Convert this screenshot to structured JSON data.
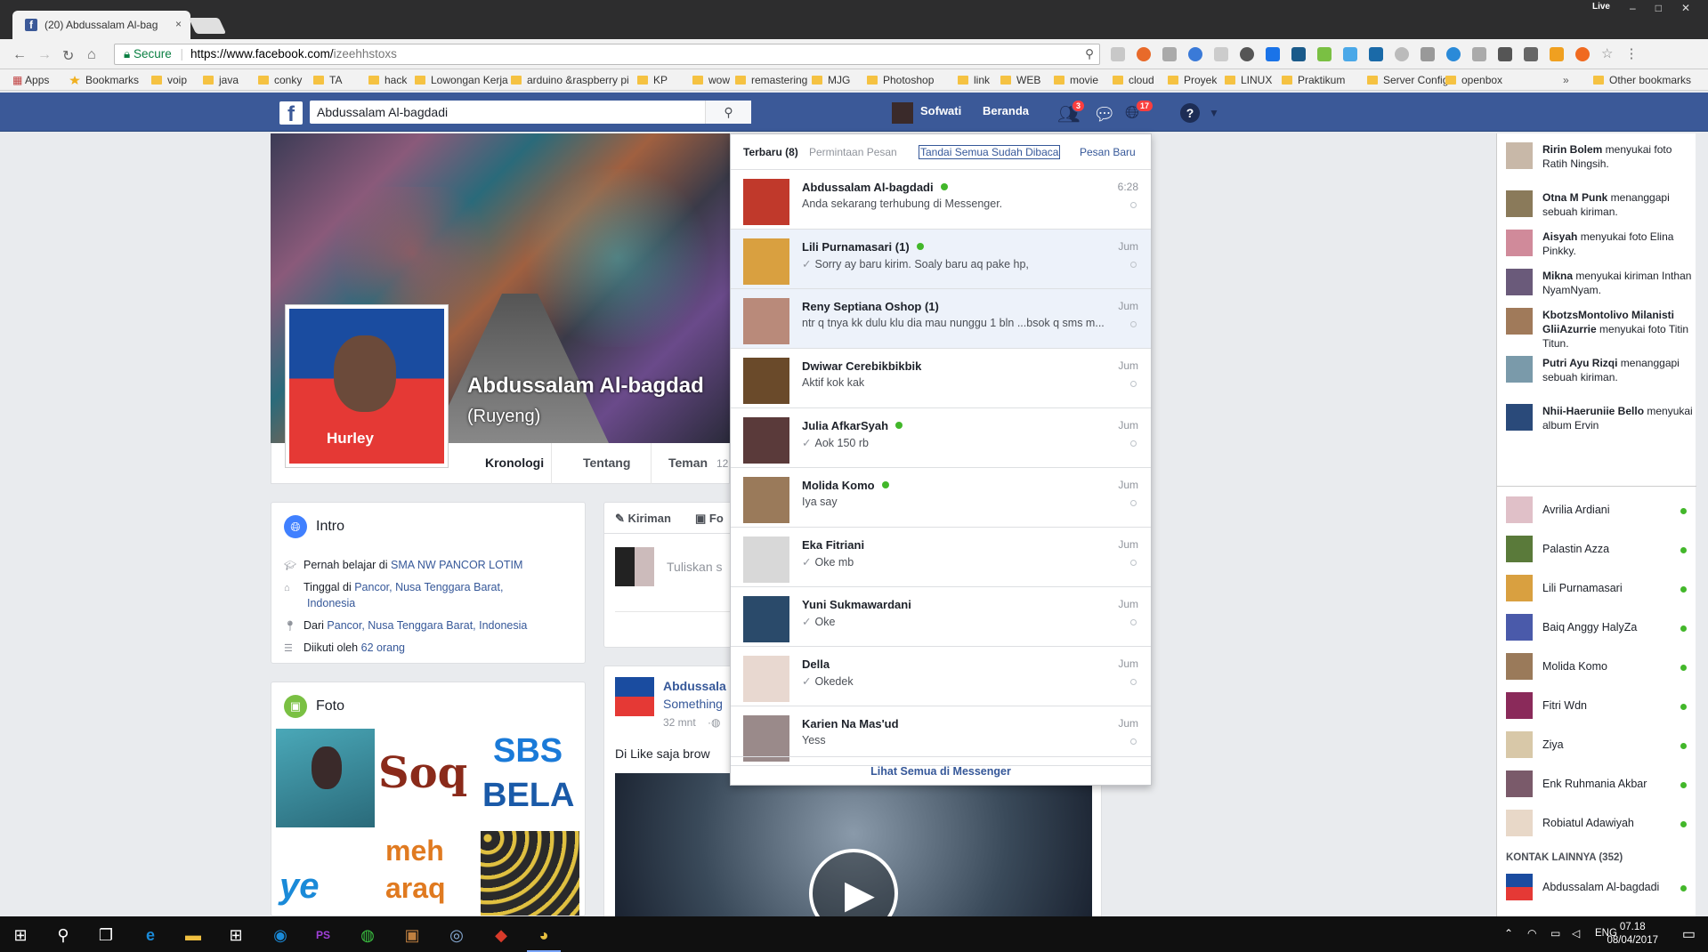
{
  "browser": {
    "tab_title": "(20) Abdussalam Al-bag",
    "tab_close": "×",
    "live_label": "Live",
    "secure_label": "Secure",
    "url_host": "https://www.facebook.com/",
    "url_path": "izeehhstoxs"
  },
  "bookmarks": {
    "apps": "Apps",
    "items": [
      "Bookmarks",
      "voip",
      "java",
      "conky",
      "TA",
      "hack",
      "Lowongan Kerja",
      "arduino &raspberry pi",
      "KP",
      "wow",
      "remastering",
      "MJG",
      "Photoshop",
      "link",
      "WEB",
      "movie",
      "cloud",
      "Proyek",
      "LINUX",
      "Praktikum",
      "Server Config",
      "openbox"
    ],
    "overflow": "»",
    "other": "Other bookmarks"
  },
  "fb": {
    "logo": "f",
    "search_value": "Abdussalam Al-bagdadi",
    "user_name": "Sofwati",
    "home_label": "Beranda",
    "friend_badge": "3",
    "notif_badge": "17"
  },
  "profile": {
    "name": "Abdussalam Al-bagdad",
    "alt_name": "(Ruyeng)",
    "shirt_text": "Hurley",
    "tabs": [
      "Kronologi",
      "Tentang",
      "Teman"
    ],
    "friends_count": "12"
  },
  "intro": {
    "title": "Intro",
    "studied_prefix": "Pernah belajar di ",
    "studied_link": "SMA NW PANCOR LOTIM",
    "lives_prefix": "Tinggal di ",
    "lives_link": "Pancor, Nusa Tenggara Barat,",
    "lives_link2": "Indonesia",
    "from_prefix": "Dari ",
    "from_link": "Pancor, Nusa Tenggara Barat, Indonesia",
    "followed_prefix": "Diikuti oleh ",
    "followed_link": "62 orang"
  },
  "photos": {
    "title": "Foto",
    "tile_texts": [
      "Soq",
      "SBS",
      "BELA",
      "meh",
      "araq",
      "ye"
    ]
  },
  "composer": {
    "tab_post": "Kiriman",
    "tab_photo": "Fo",
    "placeholder": "Tuliskan s"
  },
  "post": {
    "author": "Abdussala",
    "subtitle": "Something",
    "time": "32 mnt",
    "text": "Di Like saja brow"
  },
  "messenger": {
    "tab_recent": "Terbaru (8)",
    "tab_requests": "Permintaan Pesan",
    "mark_read": "Tandai Semua Sudah Dibaca",
    "new_message": "Pesan Baru",
    "footer": "Lihat Semua di Messenger",
    "threads": [
      {
        "name": "Abdussalam Al-bagdadi",
        "online": true,
        "check": false,
        "preview": "Anda sekarang terhubung di Messenger.",
        "time": "6:28",
        "unread": false,
        "color": "#c0392b"
      },
      {
        "name": "Lili Purnamasari (1)",
        "online": true,
        "check": true,
        "preview": "Sorry ay baru kirim. Soaly baru aq pake hp,",
        "time": "Jum",
        "unread": true,
        "color": "#d9a040"
      },
      {
        "name": "Reny Septiana Oshop (1)",
        "online": false,
        "check": false,
        "preview": "ntr q tnya kk dulu klu dia mau nunggu 1 bln ...bsok q sms m...",
        "time": "Jum",
        "unread": true,
        "color": "#b98a7a"
      },
      {
        "name": "Dwiwar Cerebikbikbik",
        "online": false,
        "check": false,
        "preview": "Aktif kok kak",
        "time": "Jum",
        "unread": false,
        "color": "#6a4a2a"
      },
      {
        "name": "Julia AfkarSyah",
        "online": true,
        "check": true,
        "preview": "Aok 150 rb",
        "time": "Jum",
        "unread": false,
        "color": "#5a3a3a"
      },
      {
        "name": "Molida Komo",
        "online": true,
        "check": false,
        "preview": "Iya say",
        "time": "Jum",
        "unread": false,
        "color": "#9a7a5a"
      },
      {
        "name": "Eka Fitriani",
        "online": false,
        "check": true,
        "preview": "Oke mb",
        "time": "Jum",
        "unread": false,
        "color": "#d8d8d8"
      },
      {
        "name": "Yuni Sukmawardani",
        "online": false,
        "check": true,
        "preview": "Oke",
        "time": "Jum",
        "unread": false,
        "color": "#2a4a6a"
      },
      {
        "name": "Della",
        "online": false,
        "check": true,
        "preview": "Okedek",
        "time": "Jum",
        "unread": false,
        "color": "#e8d8d0"
      },
      {
        "name": "Karien Na Mas'ud",
        "online": false,
        "check": false,
        "preview": "Yess",
        "time": "Jum",
        "unread": false,
        "color": "#9a8a8a"
      }
    ]
  },
  "ticker": [
    {
      "name": "Ririn Bolem",
      "rest": " menyukai foto Ratih Ningsih.",
      "color": "#c8b8a8"
    },
    {
      "name": "Otna M Punk",
      "rest": " menanggapi sebuah kiriman.",
      "color": "#8a7a5a"
    },
    {
      "name": "Aisyah",
      "rest": " menyukai foto Elina Pinkky.",
      "color": "#d08a9a"
    },
    {
      "name": "Mikna",
      "rest": " menyukai kiriman Inthan NyamNyam.",
      "color": "#6a5a7a"
    },
    {
      "name": "KbotzsMontolivo Milanisti GliiAzurrie",
      "rest": " menyukai foto Titin Titun.",
      "color": "#a07a5a"
    },
    {
      "name": "Putri Ayu Rizqi",
      "rest": " menanggapi sebuah kiriman.",
      "color": "#7a9aaa"
    },
    {
      "name": "Nhii-Haeruniie Bello",
      "rest": " menyukai album Ervin",
      "color": "#2a4a7a"
    }
  ],
  "contacts": [
    {
      "name": "Avrilia Ardiani",
      "color": "#e0c0c8"
    },
    {
      "name": "Palastin Azza",
      "color": "#5a7a3a"
    },
    {
      "name": "Lili Purnamasari",
      "color": "#d9a040"
    },
    {
      "name": "Baiq Anggy HalyZa",
      "color": "#4a5aaa"
    },
    {
      "name": "Molida Komo",
      "color": "#9a7a5a"
    },
    {
      "name": "Fitri Wdn",
      "color": "#8a2a5a"
    },
    {
      "name": "Ziya",
      "color": "#d8c8a8"
    },
    {
      "name": "Enk Ruhmania Akbar",
      "color": "#7a5a6a"
    },
    {
      "name": "Robiatul Adawiyah",
      "color": "#e8d8c8"
    }
  ],
  "more_contacts_label": "KONTAK LAINNYA (352)",
  "more_contact": {
    "name": "Abdussalam Al-bagdadi",
    "color": "#c0392b"
  },
  "taskbar": {
    "time": "07.18",
    "date": "08/04/2017",
    "lang": "ENG"
  },
  "colors": {
    "fb_blue": "#3b5998",
    "online": "#42b72a",
    "link": "#365899"
  }
}
